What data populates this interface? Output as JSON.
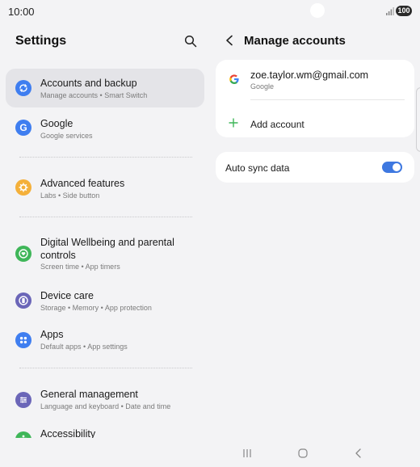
{
  "status": {
    "time": "10:00",
    "battery": "100"
  },
  "settings": {
    "title": "Settings",
    "items": [
      {
        "title": "Accounts and backup",
        "subtitle": "Manage accounts  •  Smart Switch",
        "icon": "sync-icon",
        "color": "#3f7ef0"
      },
      {
        "title": "Google",
        "subtitle": "Google services",
        "icon": "google-g-icon",
        "color": "#3f7ef0"
      },
      {
        "title": "Advanced features",
        "subtitle": "Labs  •  Side button",
        "icon": "gear-plus-icon",
        "color": "#f4b03a"
      },
      {
        "title": "Digital Wellbeing and parental controls",
        "subtitle": "Screen time  •  App timers",
        "icon": "heart-ring-icon",
        "color": "#3fb659"
      },
      {
        "title": "Device care",
        "subtitle": "Storage  •  Memory  •  App protection",
        "icon": "device-care-icon",
        "color": "#6b66b8"
      },
      {
        "title": "Apps",
        "subtitle": "Default apps  •  App settings",
        "icon": "apps-grid-icon",
        "color": "#3f7ef0"
      },
      {
        "title": "General management",
        "subtitle": "Language and keyboard  •  Date and time",
        "icon": "sliders-icon",
        "color": "#6b66b8"
      },
      {
        "title": "Accessibility",
        "subtitle": "",
        "icon": "accessibility-icon",
        "color": "#3fb659"
      }
    ]
  },
  "manage": {
    "title": "Manage accounts",
    "account": {
      "email": "zoe.taylor.wm@gmail.com",
      "provider": "Google"
    },
    "add_label": "Add account",
    "sync_label": "Auto sync data",
    "sync_on": true
  },
  "colors": {
    "accent": "#3e78e0",
    "selected_bg": "#e4e4e8",
    "background": "#f3f3f5"
  }
}
